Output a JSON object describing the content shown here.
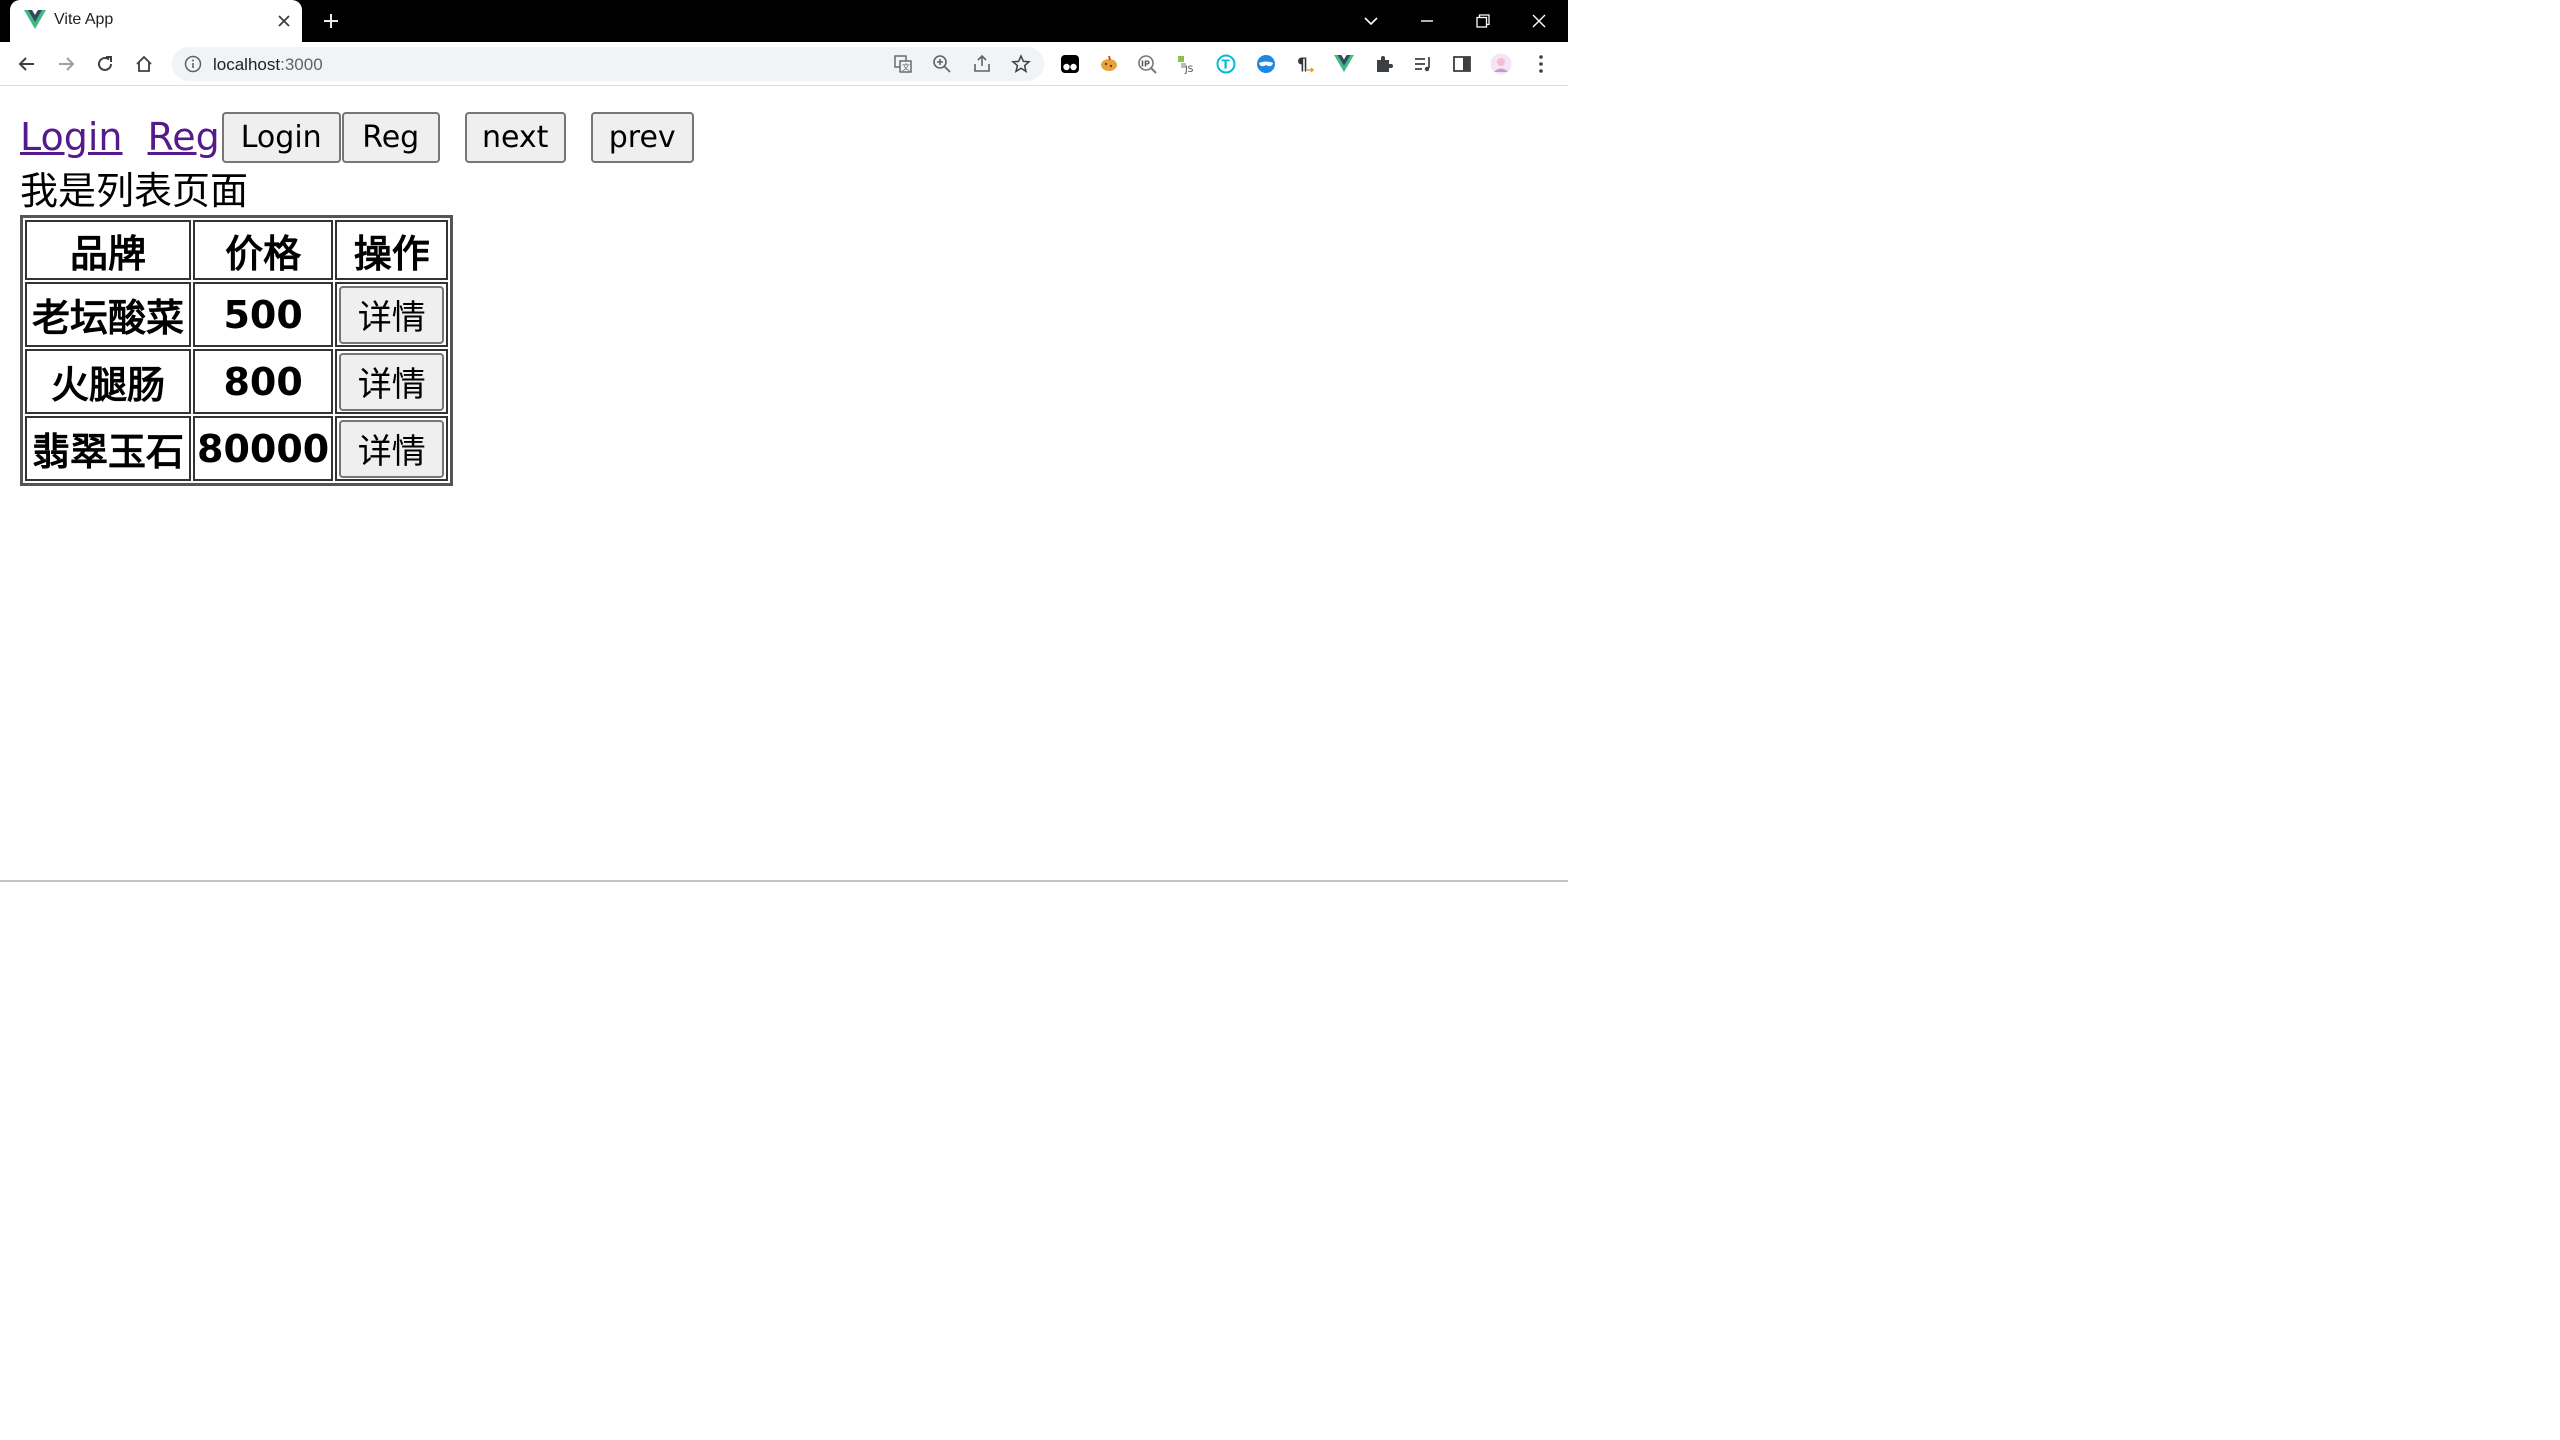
{
  "browser": {
    "tab_title": "Vite App",
    "url_host": "localhost",
    "url_port": ":3000"
  },
  "nav": {
    "link_login": "Login",
    "link_reg": "Reg",
    "btn_login": "Login",
    "btn_reg": "Reg",
    "btn_next": "next",
    "btn_prev": "prev"
  },
  "page": {
    "heading": "我是列表页面"
  },
  "table": {
    "headers": [
      "品牌",
      "价格",
      "操作"
    ],
    "rows": [
      {
        "brand": "老坛酸菜",
        "price": "500",
        "action": "详情"
      },
      {
        "brand": "火腿肠",
        "price": "800",
        "action": "详情"
      },
      {
        "brand": "翡翠玉石",
        "price": "80000",
        "action": "详情"
      }
    ]
  },
  "colors": {
    "link_visited": "#551a8b",
    "button_bg": "#efefef",
    "vue_green": "#42b883",
    "vue_dark": "#35495e"
  },
  "icons": {
    "favicon": "vue-logo-icon",
    "extensions": [
      "tampermonkey-icon",
      "cookie-icon",
      "ip-icon",
      "js-icon",
      "translate-t-icon",
      "mask-icon",
      "paragraph-icon",
      "vue-devtools-icon",
      "puzzle-icon",
      "media-control-icon",
      "side-panel-icon",
      "profile-avatar-icon",
      "kebab-menu-icon"
    ]
  }
}
